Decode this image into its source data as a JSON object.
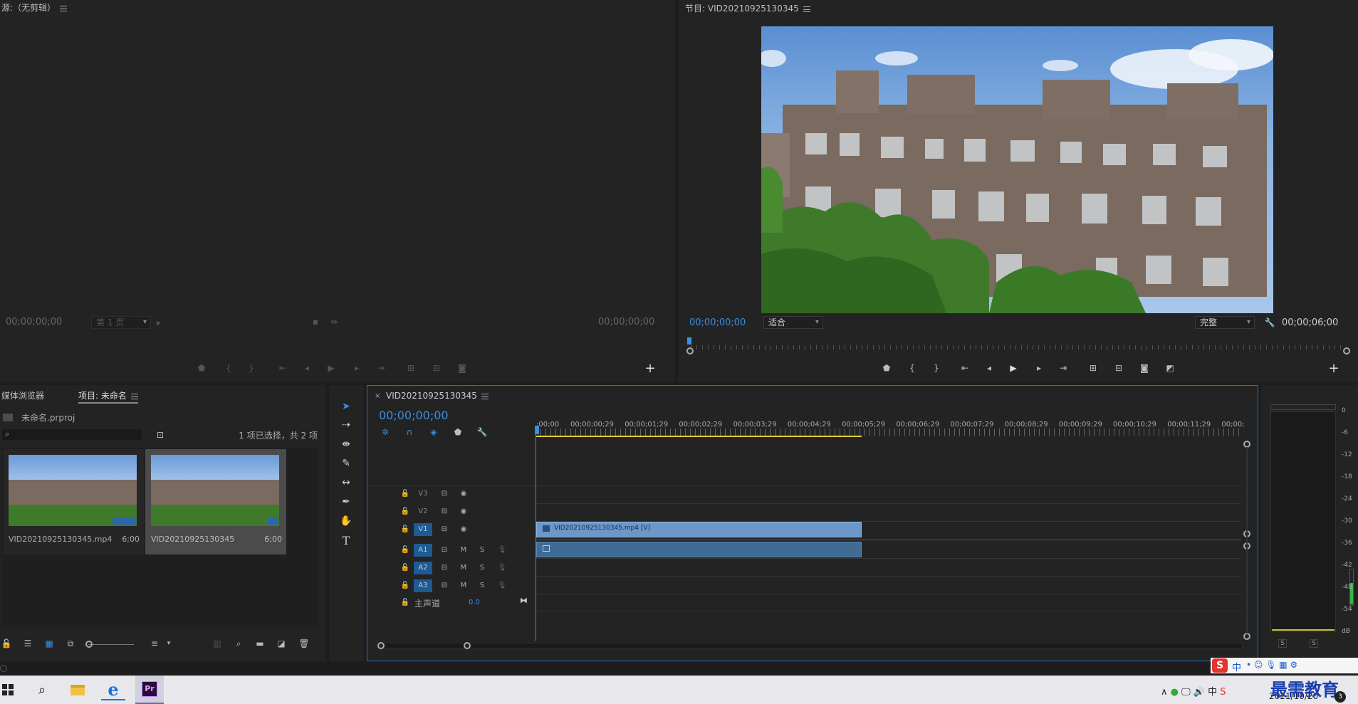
{
  "source_panel": {
    "title": "源:（无剪辑）",
    "timecode_in": "00;00;00;00",
    "page_select": "第 1 页",
    "timecode_out": "00;00;00;00"
  },
  "program_panel": {
    "title": "节目: VID20210925130345",
    "timecode_current": "00;00;00;00",
    "fit_select": "适合",
    "quality_select": "完整",
    "duration": "00;00;06;00"
  },
  "project_panel": {
    "tab_media_browser": "媒体浏览器",
    "tab_project": "项目: 未命名",
    "project_file": "未命名.prproj",
    "search_placeholder": "",
    "selection_status": "1 项已选择，共 2 项",
    "items": [
      {
        "name": "VID20210925130345.mp4",
        "duration": "6;00"
      },
      {
        "name": "VID20210925130345",
        "duration": "6;00"
      }
    ]
  },
  "timeline": {
    "sequence_name": "VID20210925130345",
    "timecode": "00;00;00;00",
    "ruler_labels": [
      ":00;00",
      "00;00;00;29",
      "00;00;01;29",
      "00;00;02;29",
      "00;00;03;29",
      "00;00;04;29",
      "00;00;05;29",
      "00;00;06;29",
      "00;00;07;29",
      "00;00;08;29",
      "00;00;09;29",
      "00;00;10;29",
      "00;00;11;29",
      "00;00;"
    ],
    "video_tracks": [
      "V3",
      "V2",
      "V1"
    ],
    "audio_tracks": [
      "A1",
      "A2",
      "A3"
    ],
    "track_m": "M",
    "track_s": "S",
    "master_label": "主声道",
    "master_value": "0.0",
    "video_clip_name": "VID20210925130345.mp4 [V]"
  },
  "audio_meter": {
    "db_labels": [
      "0",
      "-6",
      "-12",
      "-18",
      "-24",
      "-30",
      "-36",
      "-42",
      "-48",
      "-54",
      "dB"
    ],
    "solo_left": "S",
    "solo_right": "S"
  },
  "taskbar": {
    "date": "2021/10/20",
    "ime_label": "中",
    "watermark": "最需教育",
    "premiere_label": "Pr",
    "badge": "3"
  },
  "colors": {
    "accent_blue": "#3a8ee6",
    "clip_video": "#6b97c9",
    "clip_audio": "#3f6b94",
    "work_area": "#e3d13b",
    "premiere_purple": "#2a0a3a"
  }
}
